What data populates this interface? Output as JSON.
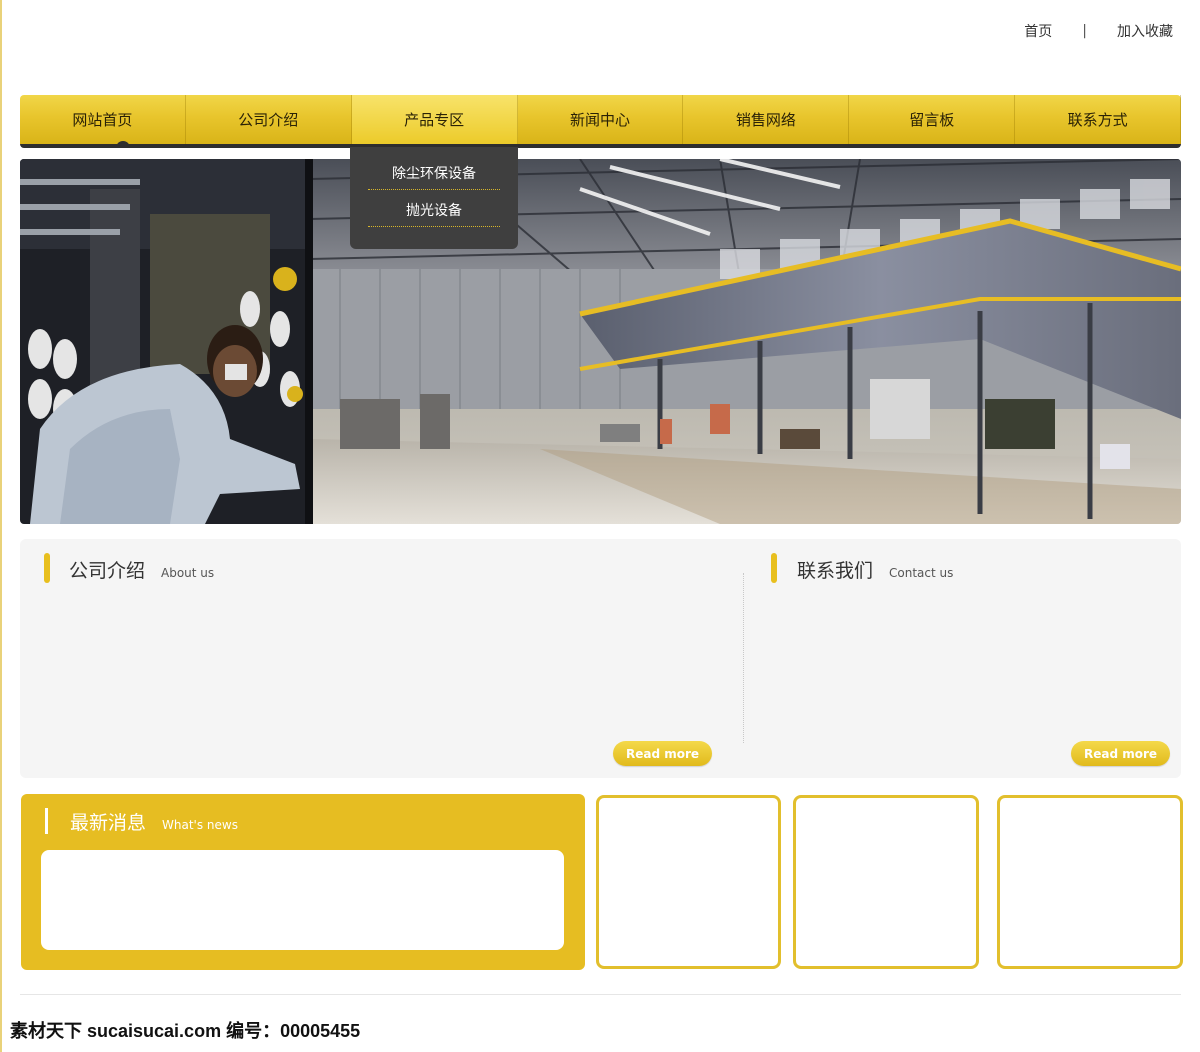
{
  "top_links": {
    "home": "首页",
    "separator": "|",
    "favorite": "加入收藏"
  },
  "nav": {
    "items": [
      {
        "label": "网站首页"
      },
      {
        "label": "公司介绍"
      },
      {
        "label": "产品专区"
      },
      {
        "label": "新闻中心"
      },
      {
        "label": "销售网络"
      },
      {
        "label": "留言板"
      },
      {
        "label": "联系方式"
      }
    ],
    "active_index": 2
  },
  "dropdown": {
    "items": [
      {
        "label": "除尘环保设备"
      },
      {
        "label": "抛光设备"
      }
    ]
  },
  "about": {
    "title": "公司介绍",
    "subtitle": "About us",
    "read_more": "Read more"
  },
  "contact": {
    "title": "联系我们",
    "subtitle": "Contact us",
    "read_more": "Read more"
  },
  "news": {
    "title": "最新消息",
    "subtitle": "What's news"
  },
  "watermark": {
    "text": "素材天下 sucaisucai.com  编号：00005455"
  },
  "colors": {
    "accent": "#e6bd22",
    "nav_dark": "#2e2e2e",
    "dropdown_bg": "#3f3f3f",
    "panel_bg": "#f5f5f5"
  }
}
